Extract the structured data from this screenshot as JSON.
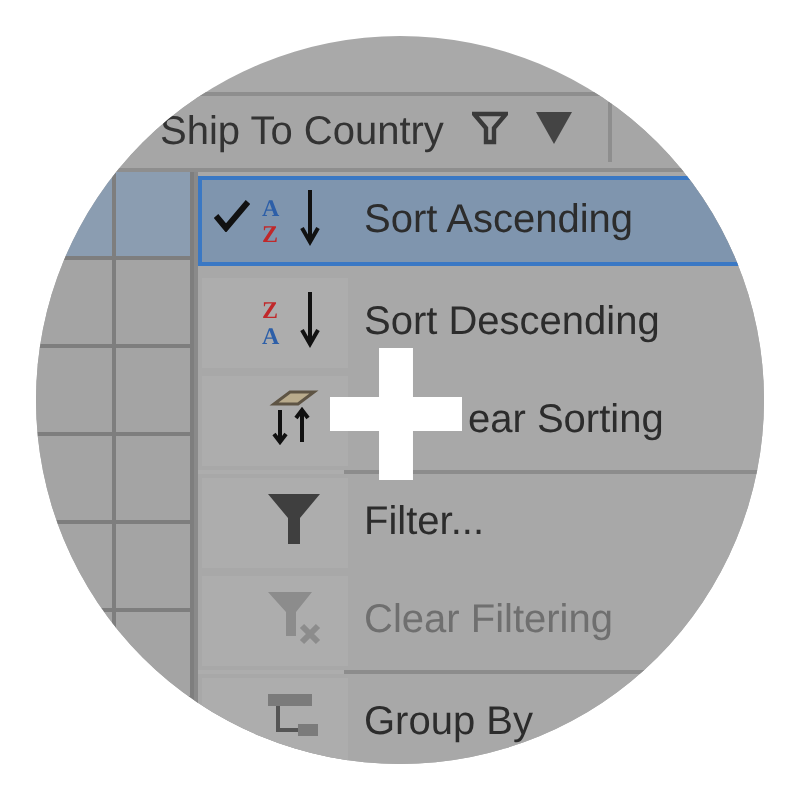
{
  "header": {
    "column_title": "Ship To Country"
  },
  "grid": {
    "rows": [
      {
        "selected": true
      },
      {
        "selected": false
      },
      {
        "selected": false
      },
      {
        "selected": false
      },
      {
        "selected": false
      },
      {
        "selected": false
      }
    ]
  },
  "menu": {
    "items": [
      {
        "kind": "item",
        "icon_letters": [
          "A",
          "Z"
        ],
        "label": "Sort Ascending",
        "checked": true,
        "selected": true,
        "disabled": false,
        "cursor": false
      },
      {
        "kind": "item",
        "icon_letters": [
          "Z",
          "A"
        ],
        "label": "Sort Descending",
        "checked": false,
        "selected": false,
        "disabled": false,
        "cursor": false
      },
      {
        "kind": "item",
        "label": "ear Sorting",
        "checked": false,
        "selected": false,
        "disabled": false,
        "cursor": true
      },
      {
        "kind": "separator"
      },
      {
        "kind": "item",
        "label": "Filter...",
        "checked": false,
        "selected": false,
        "disabled": false,
        "cursor": false
      },
      {
        "kind": "item",
        "label": "Clear Filtering",
        "checked": false,
        "selected": false,
        "disabled": true,
        "cursor": false
      },
      {
        "kind": "separator"
      },
      {
        "kind": "item",
        "label": "Group By",
        "checked": false,
        "selected": false,
        "disabled": false,
        "cursor": false
      }
    ]
  }
}
